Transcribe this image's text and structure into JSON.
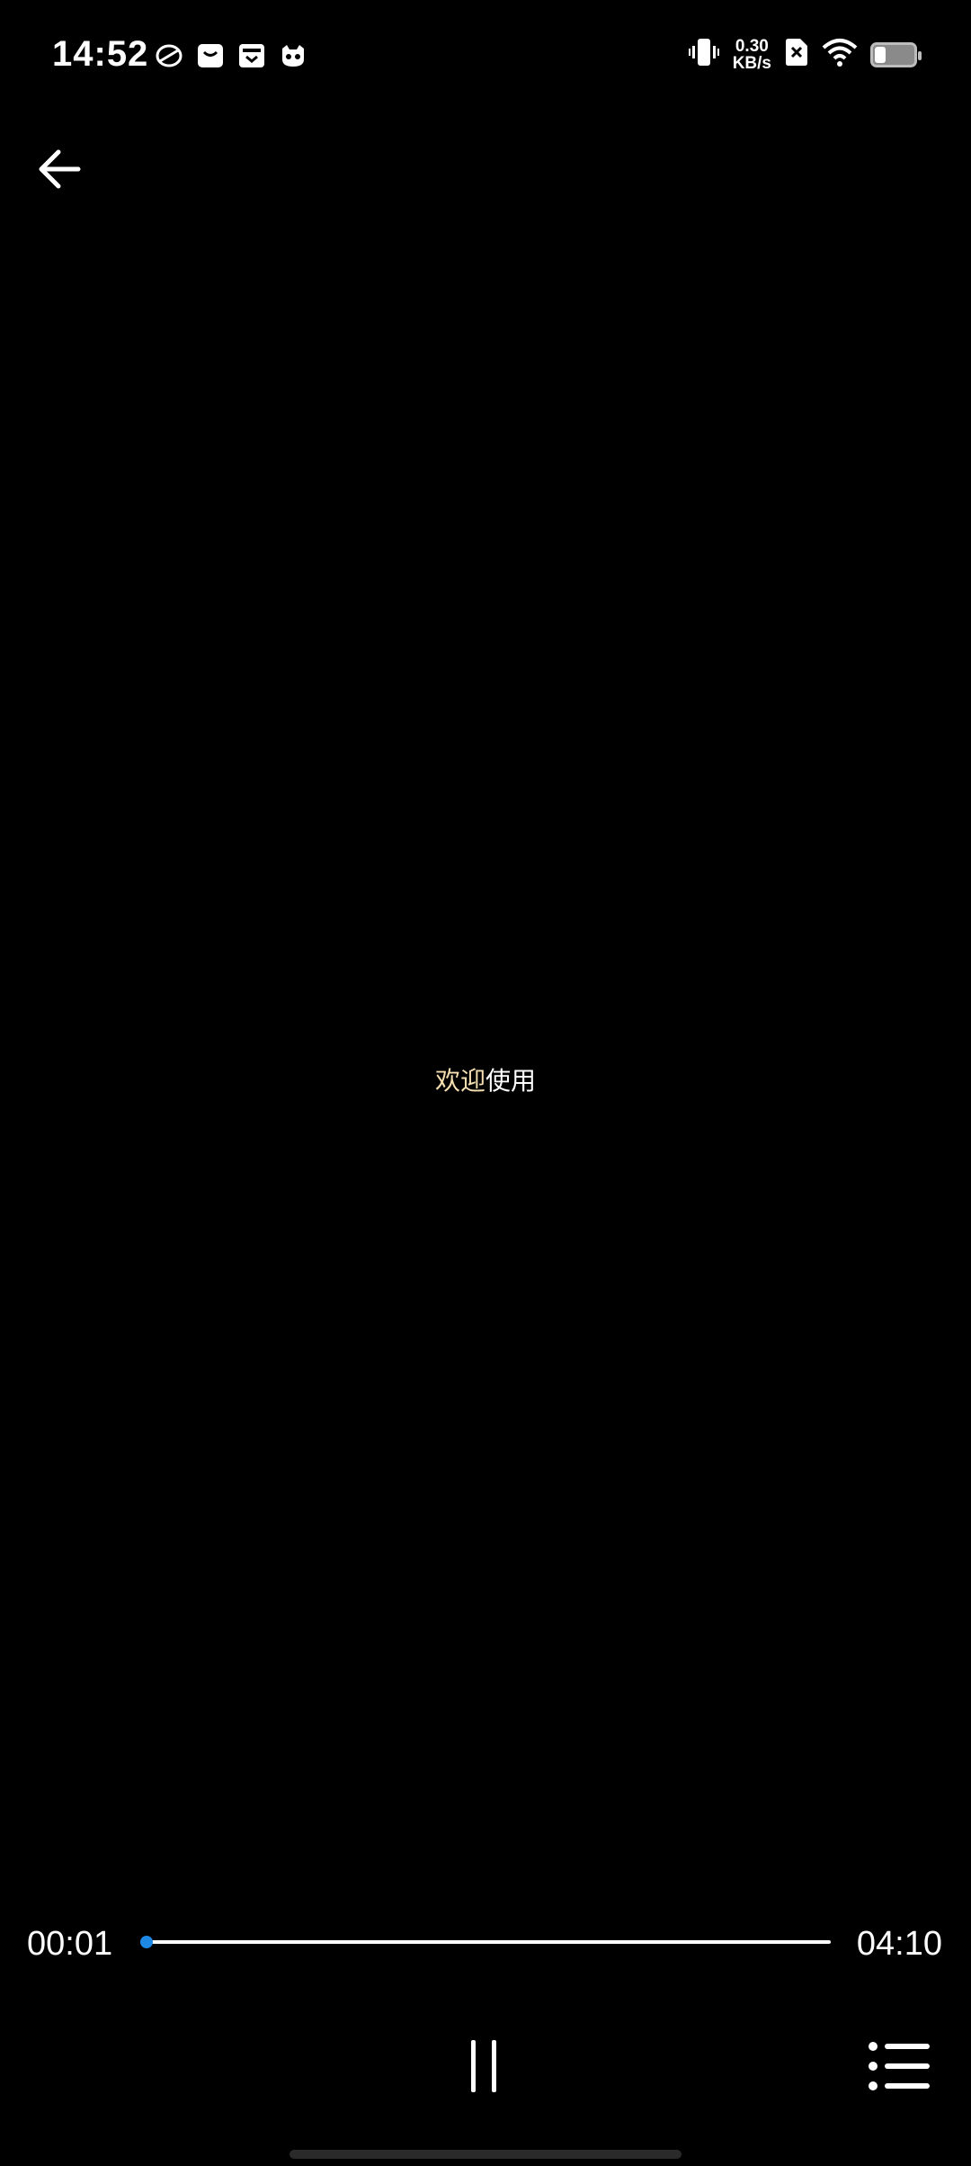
{
  "status_bar": {
    "time": "14:52",
    "notification_icons": [
      "app-icon-1",
      "mail-icon",
      "wallet-icon",
      "cat-app-icon"
    ],
    "net_speed_value": "0.30",
    "net_speed_unit": "KB/s",
    "icons": [
      "vibrate-icon",
      "sim-off-icon",
      "wifi-icon",
      "battery-icon"
    ]
  },
  "navigation": {
    "back_icon": "back-arrow-icon"
  },
  "content": {
    "subtitle_highlight": "欢迎",
    "subtitle_rest": "使用",
    "colors": {
      "highlight": "#f5deb0",
      "normal": "#ffffff"
    }
  },
  "player": {
    "current_time": "00:01",
    "total_time": "04:10",
    "progress_fraction": 0.004,
    "accent_color": "#1e88e5",
    "pause_icon": "pause-icon",
    "playlist_icon": "playlist-icon"
  }
}
